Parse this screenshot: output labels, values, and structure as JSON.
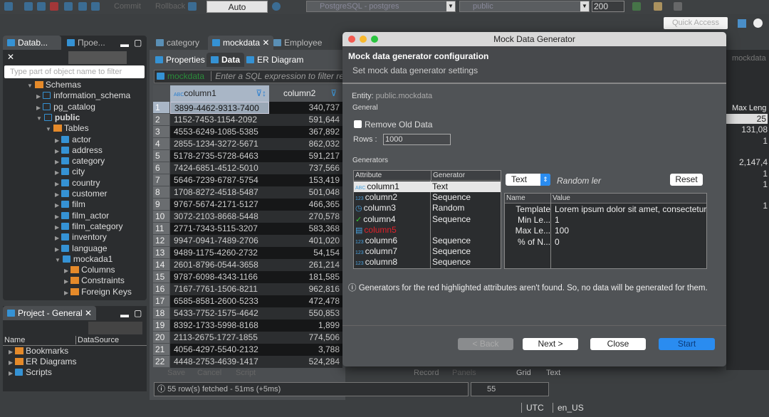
{
  "toolbar": {
    "commit_label": "Commit",
    "rollback_label": "Rollback",
    "mode_label": "Auto",
    "datasource_value": "PostgreSQL - postgres",
    "schema_value": "public",
    "limit_value": "200",
    "quick_access_placeholder": "Quick Access"
  },
  "left_panel": {
    "tabs": [
      {
        "label": "Datab..."
      },
      {
        "label": "Прое..."
      }
    ],
    "filter_placeholder": "Type part of object name to filter",
    "tree": [
      {
        "label": "Schemas",
        "level": 0,
        "expanded": true,
        "icon": "folder"
      },
      {
        "label": "information_schema",
        "level": 1,
        "expanded": false,
        "icon": "schema"
      },
      {
        "label": "pg_catalog",
        "level": 1,
        "expanded": false,
        "icon": "schema"
      },
      {
        "label": "public",
        "level": 1,
        "expanded": true,
        "icon": "schema",
        "bold": true
      },
      {
        "label": "Tables",
        "level": 2,
        "expanded": true,
        "icon": "folder"
      },
      {
        "label": "actor",
        "level": 3,
        "icon": "table"
      },
      {
        "label": "address",
        "level": 3,
        "icon": "table"
      },
      {
        "label": "category",
        "level": 3,
        "icon": "table"
      },
      {
        "label": "city",
        "level": 3,
        "icon": "table"
      },
      {
        "label": "country",
        "level": 3,
        "icon": "table"
      },
      {
        "label": "customer",
        "level": 3,
        "icon": "table"
      },
      {
        "label": "film",
        "level": 3,
        "icon": "table"
      },
      {
        "label": "film_actor",
        "level": 3,
        "icon": "table"
      },
      {
        "label": "film_category",
        "level": 3,
        "icon": "table"
      },
      {
        "label": "inventory",
        "level": 3,
        "icon": "table"
      },
      {
        "label": "language",
        "level": 3,
        "icon": "table"
      },
      {
        "label": "mockada1",
        "level": 3,
        "icon": "table",
        "expanded": true
      },
      {
        "label": "Columns",
        "level": 4,
        "icon": "folder"
      },
      {
        "label": "Constraints",
        "level": 4,
        "icon": "folder"
      },
      {
        "label": "Foreign Keys",
        "level": 4,
        "icon": "folder"
      }
    ]
  },
  "project_panel": {
    "tab_label": "Project - General",
    "columns": [
      "Name",
      "DataSource"
    ],
    "items": [
      {
        "label": "Bookmarks"
      },
      {
        "label": "ER Diagrams"
      },
      {
        "label": "Scripts"
      }
    ]
  },
  "editor": {
    "tabs": [
      {
        "label": "category"
      },
      {
        "label": "mockdata",
        "active": true
      },
      {
        "label": "Employee"
      }
    ],
    "subtabs": [
      {
        "label": "Properties"
      },
      {
        "label": "Data",
        "active": true
      },
      {
        "label": "ER Diagram"
      }
    ],
    "filter_entity": "mockdata",
    "filter_placeholder": "Enter a SQL expression to filter results",
    "grid": {
      "columns": [
        "column1",
        "column2"
      ],
      "rows": [
        [
          "3899-4462-9313-7400",
          "340,737"
        ],
        [
          "1152-7453-1154-2092",
          "591,644"
        ],
        [
          "4553-6249-1085-5385",
          "367,892"
        ],
        [
          "2855-1234-3272-5671",
          "862,032"
        ],
        [
          "5178-2735-5728-6463",
          "591,217"
        ],
        [
          "7424-6851-4512-5010",
          "737,566"
        ],
        [
          "5646-7239-6787-5754",
          "153,419"
        ],
        [
          "1708-8272-4518-5487",
          "501,048"
        ],
        [
          "9767-5674-2171-5127",
          "466,365"
        ],
        [
          "3072-2103-8668-5448",
          "270,578"
        ],
        [
          "2771-7343-5115-3207",
          "583,368"
        ],
        [
          "9947-0941-7489-2706",
          "401,020"
        ],
        [
          "9489-1175-4260-2732",
          "54,154"
        ],
        [
          "2601-8796-0544-3658",
          "261,214"
        ],
        [
          "9787-6098-4343-1166",
          "181,585"
        ],
        [
          "7167-7761-1506-8211",
          "962,816"
        ],
        [
          "6585-8581-2600-5233",
          "472,478"
        ],
        [
          "5433-7752-1575-4642",
          "550,853"
        ],
        [
          "8392-1733-5998-8168",
          "1,899"
        ],
        [
          "2113-2675-1727-1855",
          "774,506"
        ],
        [
          "4056-4297-5540-2132",
          "3,788"
        ],
        [
          "4448-2753-4639-1417",
          "524,284"
        ]
      ]
    },
    "bottom_toolbar": {
      "save": "Save",
      "cancel": "Cancel",
      "script": "Script",
      "record": "Record",
      "panels": "Panels",
      "grid": "Grid",
      "text": "Text"
    },
    "status_text": "55 row(s) fetched - 51ms (+5ms)",
    "row_count": "55"
  },
  "right_panel": {
    "tab_label": "mockdata",
    "header": "Max Leng",
    "values": [
      "25",
      "131,08",
      "1",
      "",
      "2,147,4",
      "1",
      "1",
      "",
      "1"
    ]
  },
  "statusbar": {
    "timezone": "UTC",
    "locale": "en_US"
  },
  "dialog": {
    "title": "Mock Data Generator",
    "heading": "Mock data generator configuration",
    "subheading": "Set mock data generator settings",
    "entity_label": "Entity:",
    "entity_value": "public.mockdata",
    "general_label": "General",
    "remove_old_data_label": "Remove Old Data",
    "remove_old_data_checked": false,
    "rows_label": "Rows :",
    "rows_value": "1000",
    "generators_label": "Generators",
    "gen_columns": [
      "Attribute",
      "Generator"
    ],
    "generators": [
      {
        "attribute": "column1",
        "generator": "Text",
        "icon": "text-type",
        "selected": true
      },
      {
        "attribute": "column2",
        "generator": "Sequence",
        "icon": "number-type"
      },
      {
        "attribute": "column3",
        "generator": "Random",
        "icon": "clock-type"
      },
      {
        "attribute": "column4",
        "generator": "Sequence",
        "icon": "boolean-type"
      },
      {
        "attribute": "column5",
        "generator": "",
        "icon": "unknown-type",
        "missing": true
      },
      {
        "attribute": "column6",
        "generator": "Sequence",
        "icon": "number-type"
      },
      {
        "attribute": "column7",
        "generator": "Sequence",
        "icon": "number-type"
      },
      {
        "attribute": "column8",
        "generator": "Sequence",
        "icon": "number-type"
      }
    ],
    "generator_type": "Text",
    "generator_desc": "Random ler",
    "reset_label": "Reset",
    "prop_columns": [
      "Name",
      "Value"
    ],
    "properties": [
      {
        "name": "Template",
        "value": "Lorem ipsum dolor sit amet, consectetur a"
      },
      {
        "name": "Min Le...",
        "value": "1"
      },
      {
        "name": "Max Le...",
        "value": "100"
      },
      {
        "name": "% of N...",
        "value": "0"
      }
    ],
    "info_text": "Generators for the red highlighted attributes aren't found. So, no data will be generated for them.",
    "buttons": {
      "back": "< Back",
      "next": "Next >",
      "close": "Close",
      "start": "Start"
    },
    "colors": {
      "missing": "#e0202a",
      "start": "#2a8cf0",
      "accent": "#3592d4"
    }
  }
}
